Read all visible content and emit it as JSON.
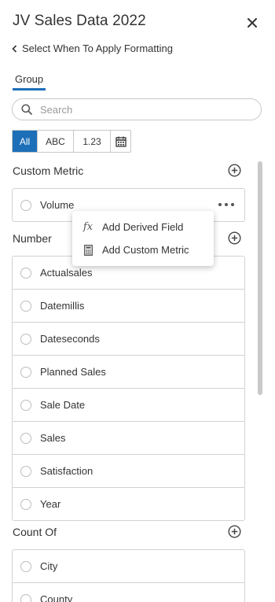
{
  "header": {
    "title": "JV Sales Data 2022",
    "back_label": "Select When To Apply Formatting"
  },
  "tabs": [
    {
      "label": "Group",
      "active": true
    }
  ],
  "search": {
    "placeholder": "Search",
    "value": ""
  },
  "filters": [
    {
      "label": "All",
      "active": true
    },
    {
      "label": "ABC",
      "active": false
    },
    {
      "label": "1.23",
      "active": false
    },
    {
      "label": "",
      "icon": "calendar-icon",
      "active": false
    }
  ],
  "sections": {
    "custom_metric": {
      "title": "Custom Metric",
      "items": [
        "Volume"
      ]
    },
    "number": {
      "title": "Number",
      "items": [
        "Actualsales",
        "Datemillis",
        "Dateseconds",
        "Planned Sales",
        "Sale Date",
        "Sales",
        "Satisfaction",
        "Year"
      ]
    },
    "count_of": {
      "title": "Count Of",
      "items": [
        "City",
        "County"
      ]
    }
  },
  "context_menu": {
    "items": [
      {
        "label": "Add Derived Field",
        "icon": "fx-icon"
      },
      {
        "label": "Add Custom Metric",
        "icon": "calculator-icon"
      }
    ]
  },
  "colors": {
    "accent": "#1d6fb8",
    "text": "#333333",
    "border": "#d2d2d2"
  }
}
